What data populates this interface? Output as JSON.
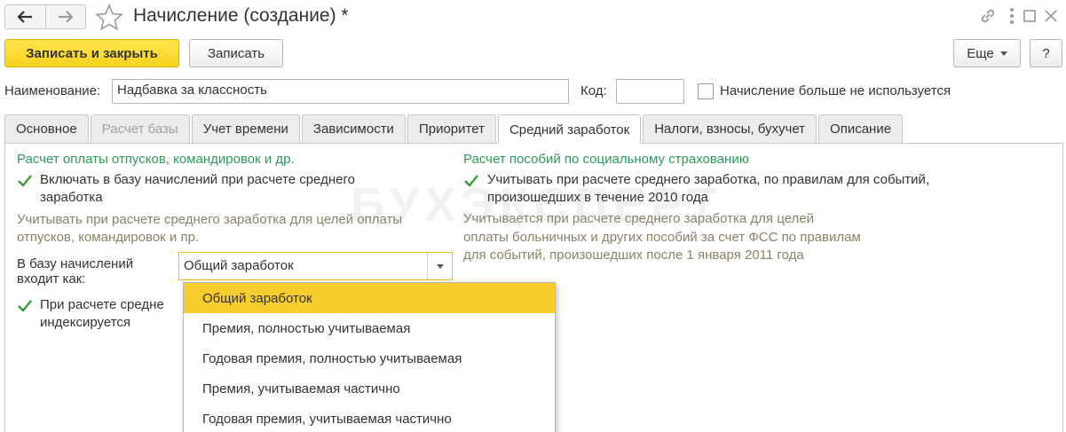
{
  "window": {
    "title": "Начисление (создание) *"
  },
  "toolbar": {
    "save_close_label": "Записать и закрыть",
    "save_label": "Записать",
    "more_label": "Еще",
    "help_label": "?"
  },
  "form": {
    "name_label": "Наименование:",
    "name_value": "Надбавка за классность",
    "code_label": "Код:",
    "code_value": "",
    "unused_label": "Начисление больше не используется",
    "unused_checked": false
  },
  "tabs": [
    {
      "label": "Основное",
      "state": "normal"
    },
    {
      "label": "Расчет базы",
      "state": "disabled"
    },
    {
      "label": "Учет времени",
      "state": "normal"
    },
    {
      "label": "Зависимости",
      "state": "normal"
    },
    {
      "label": "Приоритет",
      "state": "normal"
    },
    {
      "label": "Средний заработок",
      "state": "active"
    },
    {
      "label": "Налоги, взносы, бухучет",
      "state": "normal"
    },
    {
      "label": "Описание",
      "state": "normal"
    }
  ],
  "left_section": {
    "title": "Расчет оплаты отпусков, командировок и др.",
    "include_line1": "Включать в базу начислений при расчете среднего",
    "include_line2": "заработка",
    "include_checked": true,
    "hint_line1": "Учитывать при расчете среднего заработка для целей оплаты",
    "hint_line2": "отпусков, командировок и пр.",
    "base_label_line1": "В базу начислений",
    "base_label_line2": "входит как:",
    "base_value": "Общий заработок",
    "index_line1": "При расчете средне",
    "index_line2": "индексируется",
    "index_checked": true
  },
  "right_section": {
    "title": "Расчет пособий по социальному страхованию",
    "consider_line1": "Учитывать при расчете среднего заработка, по правилам для событий,",
    "consider_line2": "произошедших в течение 2010 года",
    "consider_checked": true,
    "hint_line1": "Учитывается при расчете среднего заработка для целей",
    "hint_line2": "оплаты больничных и других пособий за счет ФСС по правилам",
    "hint_line3": "для событий, произошедших после 1 января 2011 года"
  },
  "dropdown": {
    "items": [
      {
        "label": "Общий заработок",
        "selected": true
      },
      {
        "label": "Премия, полностью учитываемая",
        "selected": false
      },
      {
        "label": "Годовая премия, полностью учитываемая",
        "selected": false
      },
      {
        "label": "Премия, учитываемая частично",
        "selected": false
      },
      {
        "label": "Годовая премия, учитываемая частично",
        "selected": false
      }
    ]
  },
  "watermark": "БУХЭКСПЕРТ",
  "colors": {
    "accent_yellow": "#f9cd2d",
    "section_green": "#2e9a5a",
    "hint_olive": "#8a8366",
    "check_green": "#3a9a3a"
  },
  "icons": [
    "back-arrow-icon",
    "forward-arrow-icon",
    "star-icon",
    "link-icon",
    "menu-dots-icon",
    "maximize-icon",
    "close-icon",
    "checkmark-icon",
    "chevron-down-icon",
    "caret-down-icon"
  ]
}
